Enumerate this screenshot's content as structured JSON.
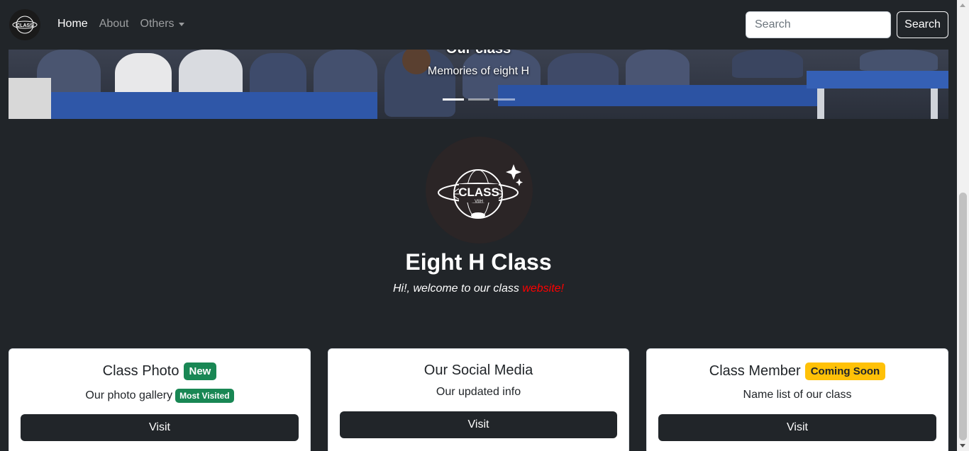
{
  "navbar": {
    "brand_logo_text": "CLASS",
    "links": [
      {
        "label": "Home"
      },
      {
        "label": "About"
      },
      {
        "label": "Others"
      }
    ],
    "search_placeholder": "Search",
    "search_button": "Search"
  },
  "carousel": {
    "caption_title": "Our class",
    "caption_subtitle": "Memories of eight H",
    "slide_count": 3,
    "active_index": 0
  },
  "hero": {
    "logo_text": "CLASS",
    "logo_subtext": "VIIH",
    "title": "Eight H Class",
    "subtitle_prefix": "Hi!, welcome to our class ",
    "subtitle_accent": "website!",
    "accent_color": "#ff0000"
  },
  "cards": [
    {
      "title": "Class Photo",
      "title_badge": "New",
      "text": "Our photo gallery",
      "text_badge": "Most Visited",
      "button": "Visit"
    },
    {
      "title": "Our Social Media",
      "text": "Our updated info",
      "button": "Visit"
    },
    {
      "title": "Class Member",
      "title_badge": "Coming Soon",
      "text": "Name list of our class",
      "button": "Visit"
    }
  ],
  "colors": {
    "background": "#212529",
    "badge_green": "#198754",
    "badge_yellow": "#ffc107"
  }
}
